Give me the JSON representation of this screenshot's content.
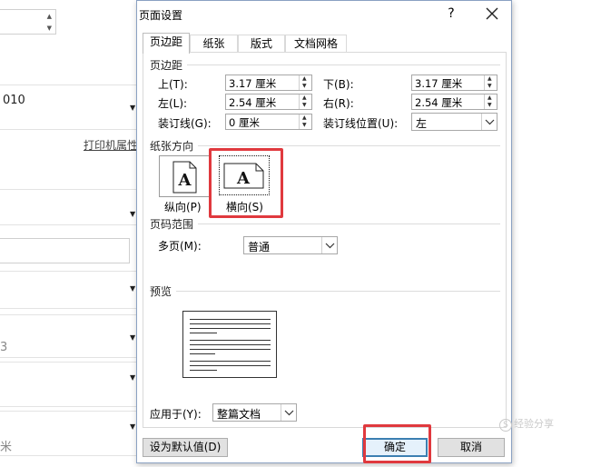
{
  "background": {
    "field_text": "010",
    "printer_link": "打印机属性",
    "faint_value_1": "3",
    "faint_value_2": "米"
  },
  "dialog": {
    "title": "页面设置",
    "help_glyph": "?",
    "tabs": [
      {
        "label": "页边距",
        "active": true
      },
      {
        "label": "纸张",
        "active": false
      },
      {
        "label": "版式",
        "active": false
      },
      {
        "label": "文档网格",
        "active": false
      }
    ],
    "margins": {
      "group_label": "页边距",
      "top_label": "上(T):",
      "top_value": "3.17 厘米",
      "bottom_label": "下(B):",
      "bottom_value": "3.17 厘米",
      "left_label": "左(L):",
      "left_value": "2.54 厘米",
      "right_label": "右(R):",
      "right_value": "2.54 厘米",
      "gutter_label": "装订线(G):",
      "gutter_value": "0 厘米",
      "gutter_pos_label": "装订线位置(U):",
      "gutter_pos_value": "左"
    },
    "orientation": {
      "group_label": "纸张方向",
      "portrait_label": "纵向(P)",
      "landscape_label": "横向(S)",
      "icon_letter": "A",
      "selected": "landscape"
    },
    "pages": {
      "group_label": "页码范围",
      "multi_label": "多页(M):",
      "multi_value": "普通"
    },
    "preview": {
      "group_label": "预览"
    },
    "apply": {
      "label": "应用于(Y):",
      "value": "整篇文档"
    },
    "buttons": {
      "default_label": "设为默认值(D)",
      "ok_label": "确定",
      "cancel_label": "取消"
    }
  },
  "highlight_color": "#e0393e",
  "watermark": {
    "text": "经验分享"
  }
}
